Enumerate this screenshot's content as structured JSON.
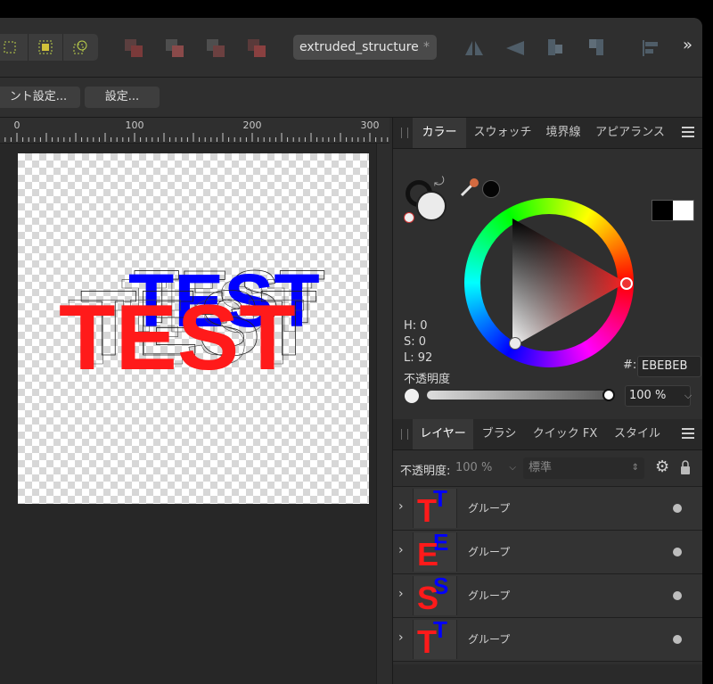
{
  "toolbar": {
    "document_tab": "extruded_structure",
    "document_tab_modified": "*",
    "overflow": "»"
  },
  "context_bar": {
    "button1": "ント設定...",
    "button2": "設定..."
  },
  "ruler": {
    "ticks": [
      "0",
      "100",
      "200",
      "300"
    ]
  },
  "artwork": {
    "front_text": "TEST",
    "back_text": "TEST",
    "front_color": "#ff1a1a",
    "back_color": "#0000ff"
  },
  "color_panel": {
    "tabs": [
      "カラー",
      "スウォッチ",
      "境界線",
      "アピアランス"
    ],
    "h_label": "H: 0",
    "s_label": "S: 0",
    "l_label": "L: 92",
    "hex_prefix": "#:",
    "hex_value": "EBEBEB",
    "opacity_label": "不透明度",
    "opacity_value": "100 %"
  },
  "layers_panel": {
    "tabs": [
      "レイヤー",
      "ブラシ",
      "クイック FX",
      "スタイル"
    ],
    "opacity_label": "不透明度:",
    "opacity_value": "100 %",
    "blend_mode": "標準",
    "layers": [
      {
        "name": "グループ",
        "letter": "T",
        "back": "T"
      },
      {
        "name": "グループ",
        "letter": "E",
        "back": "E"
      },
      {
        "name": "グループ",
        "letter": "S",
        "back": "S"
      },
      {
        "name": "グループ",
        "letter": "T",
        "back": "T"
      }
    ]
  }
}
